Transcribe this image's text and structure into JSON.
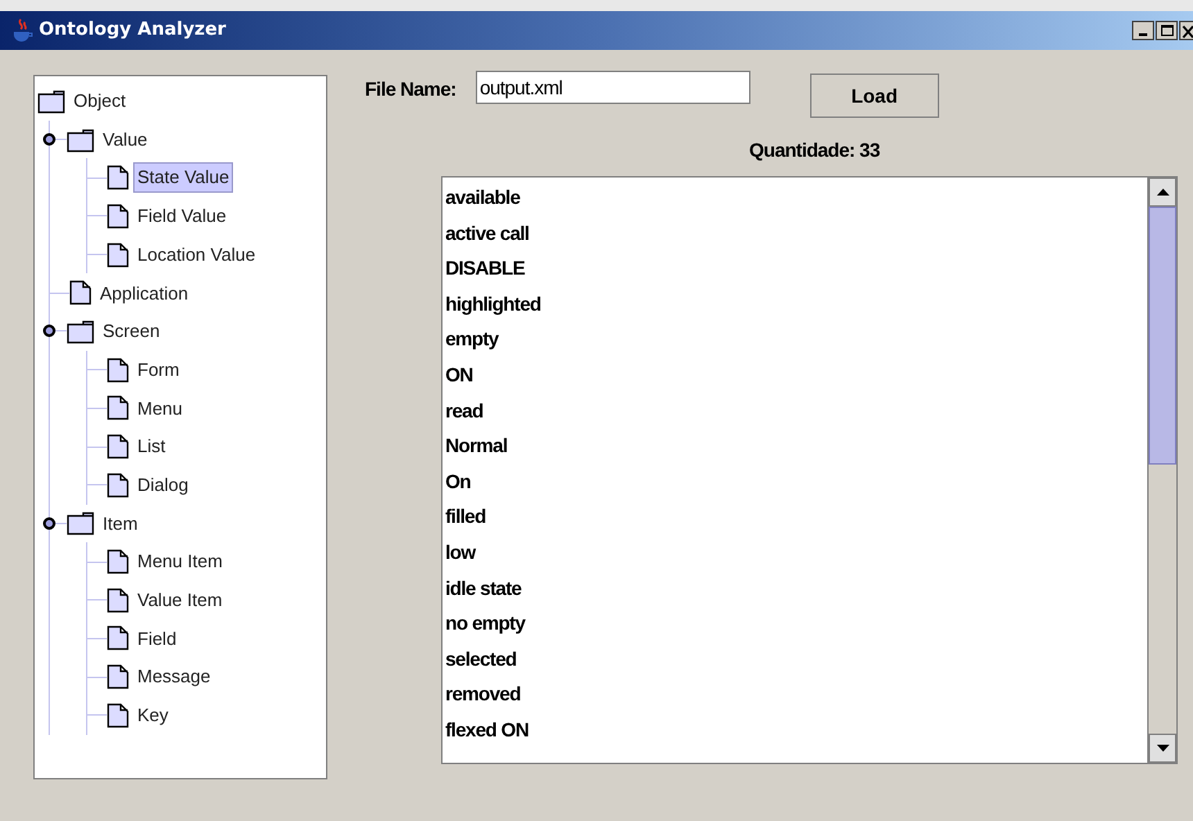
{
  "window": {
    "title": "Ontology Analyzer"
  },
  "tree": [
    {
      "label": "Object",
      "kind": "folder",
      "selected": false,
      "children": [
        {
          "label": "Value",
          "kind": "folder",
          "selected": false,
          "expanded": true,
          "children": [
            {
              "label": "State Value",
              "kind": "leaf",
              "selected": true
            },
            {
              "label": "Field Value",
              "kind": "leaf",
              "selected": false
            },
            {
              "label": "Location Value",
              "kind": "leaf",
              "selected": false
            }
          ]
        },
        {
          "label": "Application",
          "kind": "leaf",
          "selected": false
        },
        {
          "label": "Screen",
          "kind": "folder",
          "selected": false,
          "expanded": true,
          "children": [
            {
              "label": "Form",
              "kind": "leaf",
              "selected": false
            },
            {
              "label": "Menu",
              "kind": "leaf",
              "selected": false
            },
            {
              "label": "List",
              "kind": "leaf",
              "selected": false
            },
            {
              "label": "Dialog",
              "kind": "leaf",
              "selected": false
            }
          ]
        },
        {
          "label": "Item",
          "kind": "folder",
          "selected": false,
          "expanded": true,
          "children": [
            {
              "label": "Menu Item",
              "kind": "leaf",
              "selected": false
            },
            {
              "label": "Value Item",
              "kind": "leaf",
              "selected": false
            },
            {
              "label": "Field",
              "kind": "leaf",
              "selected": false
            },
            {
              "label": "Message",
              "kind": "leaf",
              "selected": false
            },
            {
              "label": "Key",
              "kind": "leaf",
              "selected": false
            }
          ]
        }
      ]
    }
  ],
  "file_name": {
    "label": "File Name:",
    "value": "output.xml"
  },
  "load_button": "Load",
  "count": "Quantidade: 33",
  "list": [
    "available",
    "active call",
    "DISABLE",
    "highlighted",
    "empty",
    "ON",
    "read",
    "Normal",
    "On",
    "filled",
    "low",
    "idle state",
    "no empty",
    "selected",
    "removed",
    "flexed ON"
  ]
}
